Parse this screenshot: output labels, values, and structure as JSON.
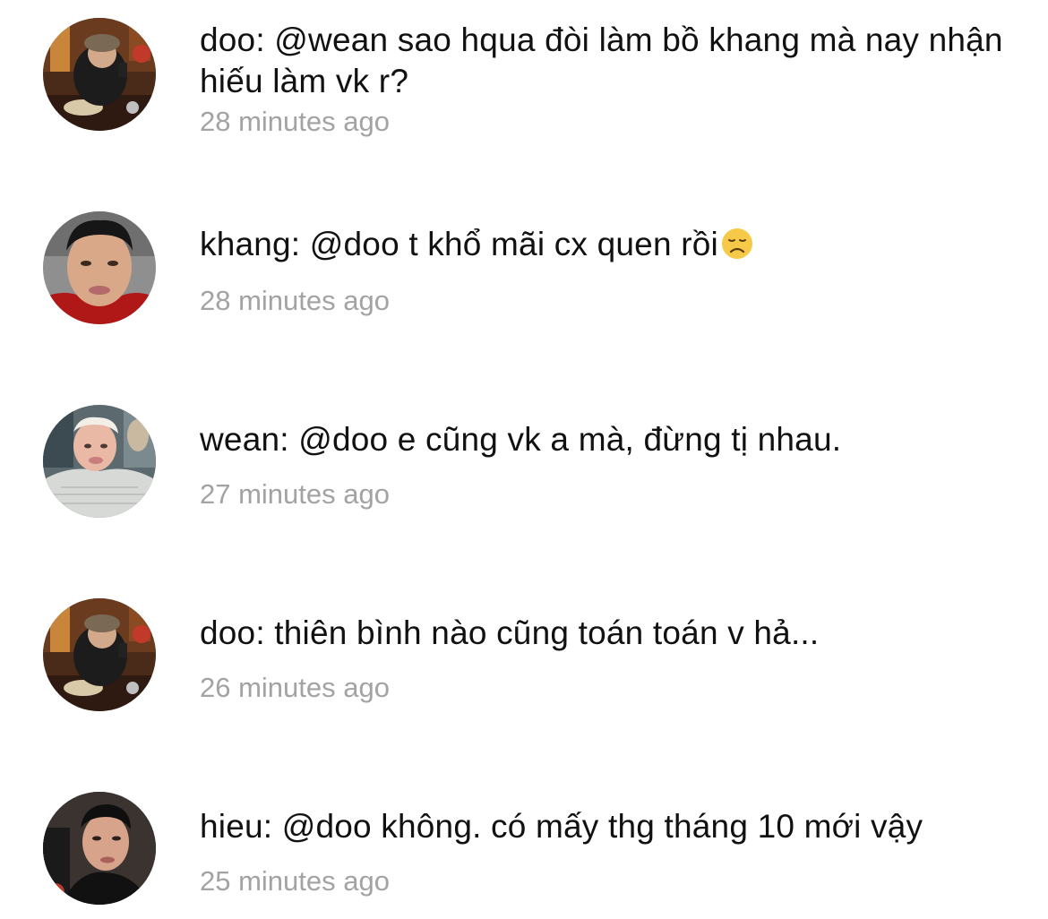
{
  "comments": [
    {
      "author": "doo",
      "text": "doo: @wean sao hqua đòi làm bồ khang mà nay nhận hiếu làm vk r?",
      "time": "28 minutes ago",
      "avatar_icon": "avatar-doo"
    },
    {
      "author": "khang",
      "text": "khang: @doo t khổ mãi cx quen rồi",
      "emoji": "disappointed-face-emoji",
      "time": "28 minutes ago",
      "avatar_icon": "avatar-khang"
    },
    {
      "author": "wean",
      "text": "wean: @doo e cũng vk a mà, đừng tị nhau.",
      "time": "27 minutes ago",
      "avatar_icon": "avatar-wean"
    },
    {
      "author": "doo",
      "text": "doo: thiên bình nào cũng toán toán v hả...",
      "time": "26 minutes ago",
      "avatar_icon": "avatar-doo"
    },
    {
      "author": "hieu",
      "text": "hieu: @doo không. có mấy thg tháng 10 mới vậy",
      "time": "25 minutes ago",
      "avatar_icon": "avatar-hieu"
    }
  ],
  "colors": {
    "text": "#111111",
    "timestamp": "#a3a3a3",
    "background": "#ffffff",
    "emoji_face": "#f7c948"
  }
}
